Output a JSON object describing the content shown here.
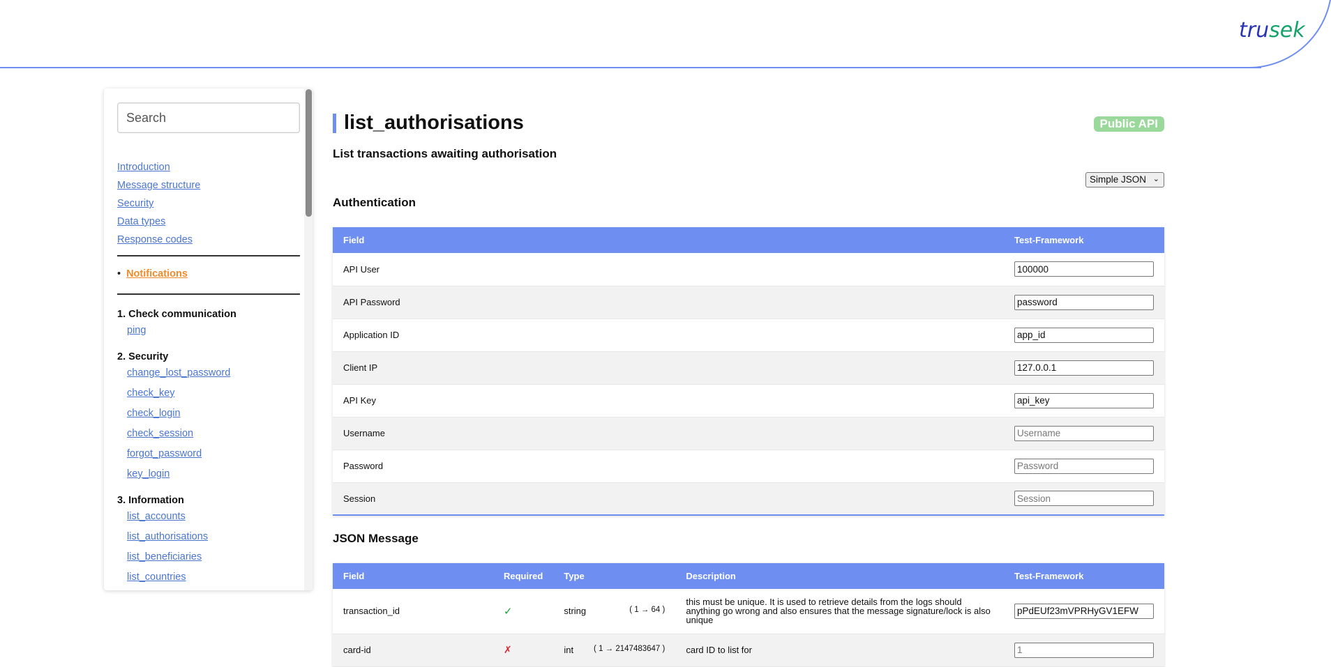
{
  "header": {
    "logo_part1": "tru",
    "logo_part2": "sek"
  },
  "sidebar": {
    "search_placeholder": "Search",
    "top_links": [
      "Introduction",
      "Message structure",
      "Security",
      "Data types",
      "Response codes"
    ],
    "notifications_bullet": "•",
    "notifications_label": "Notifications",
    "groups": [
      {
        "title": "1. Check communication",
        "items": [
          "ping"
        ]
      },
      {
        "title": "2. Security",
        "items": [
          "change_lost_password",
          "check_key",
          "check_login",
          "check_session",
          "forgot_password",
          "key_login"
        ]
      },
      {
        "title": "3. Information",
        "items": [
          "list_accounts",
          "list_authorisations",
          "list_beneficiaries",
          "list_countries"
        ]
      }
    ]
  },
  "main": {
    "title": "list_authorisations",
    "badge": "Public API",
    "subtitle": "List transactions awaiting authorisation",
    "format_select": "Simple JSON",
    "auth_heading": "Authentication",
    "auth_table": {
      "headers": [
        "Field",
        "Test-Framework"
      ],
      "rows": [
        {
          "field": "API User",
          "value": "100000",
          "placeholder": ""
        },
        {
          "field": "API Password",
          "value": "password",
          "placeholder": ""
        },
        {
          "field": "Application ID",
          "value": "app_id",
          "placeholder": ""
        },
        {
          "field": "Client IP",
          "value": "127.0.0.1",
          "placeholder": ""
        },
        {
          "field": "API Key",
          "value": "api_key",
          "placeholder": ""
        },
        {
          "field": "Username",
          "value": "",
          "placeholder": "Username"
        },
        {
          "field": "Password",
          "value": "",
          "placeholder": "Password"
        },
        {
          "field": "Session",
          "value": "",
          "placeholder": "Session"
        }
      ]
    },
    "json_heading": "JSON Message",
    "json_table": {
      "headers": [
        "Field",
        "Required",
        "Type",
        "Description",
        "Test-Framework"
      ],
      "rows": [
        {
          "field": "transaction_id",
          "required": "✓",
          "type": "string",
          "range": "( 1 → 64 )",
          "description": "this must be unique. It is used to retrieve details from the logs should anything go wrong and also ensures that the message signature/lock is also unique",
          "value": "pPdEUf23mVPRHyGV1EFW",
          "placeholder": ""
        },
        {
          "field": "card-id",
          "required": "✗",
          "type": "int",
          "range": "( 1 → 2147483647 )",
          "description": "card ID to list for",
          "value": "",
          "placeholder": "1"
        }
      ]
    }
  },
  "colors": {
    "accent": "#6e8ef2",
    "link": "#4a76d1",
    "notifications": "#f08b2b",
    "badge": "#9bd89b",
    "check": "#1aa23a",
    "cross": "#d8242e"
  }
}
